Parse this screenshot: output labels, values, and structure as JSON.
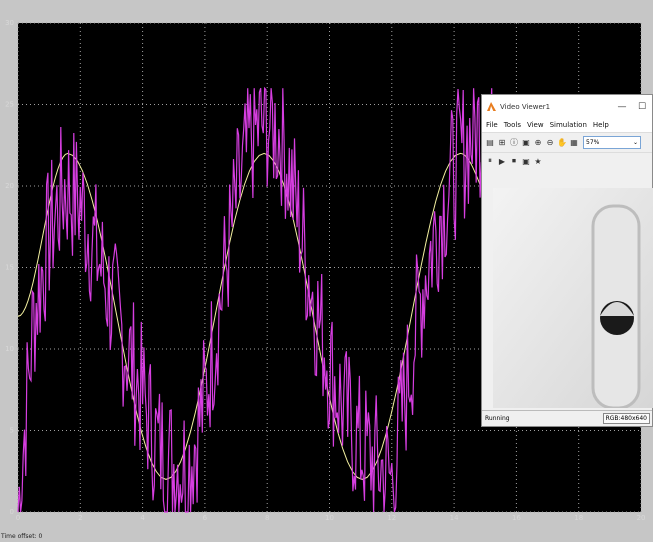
{
  "scope": {
    "time_offset_label": "Time offset:  0",
    "colors": {
      "background": "#000000",
      "frame": "#c6c6c6",
      "reference": "#f3f0a0",
      "measured": "#d63ee0",
      "grid": "#a0a0a0"
    }
  },
  "chart_data": {
    "type": "line",
    "title": "",
    "xlabel": "",
    "ylabel": "",
    "xlim": [
      0,
      20
    ],
    "ylim": [
      0,
      30
    ],
    "xticks": [
      "0",
      "2",
      "4",
      "6",
      "8",
      "10",
      "12",
      "14",
      "16",
      "18",
      "20"
    ],
    "yticks": [
      "0",
      "5",
      "10",
      "15",
      "20",
      "25",
      "30"
    ],
    "grid": true,
    "series": [
      {
        "color": "#f3f0a0",
        "x": [
          0,
          1.6,
          4.75,
          7.9,
          11.05,
          14.2,
          15.5
        ],
        "y": [
          12,
          22,
          2,
          22,
          2,
          22,
          18
        ]
      },
      {
        "color": "#d63ee0",
        "x": [
          0,
          0.5,
          1,
          1.5,
          2,
          2.5,
          3,
          3.5,
          4,
          4.5,
          5,
          5.5,
          6,
          6.5,
          7,
          7.5,
          8,
          8.5,
          9,
          9.5,
          10,
          10.5,
          11,
          11.5,
          12,
          12.5,
          13,
          13.5,
          14,
          14.5,
          15,
          15.5
        ],
        "y": [
          0,
          12,
          17,
          20,
          19,
          16,
          13,
          10,
          7,
          4,
          3,
          3,
          7,
          13,
          19,
          23,
          24,
          23,
          18,
          13,
          9,
          6,
          4,
          3,
          2,
          8,
          14,
          18,
          21,
          23,
          24,
          23
        ]
      }
    ]
  },
  "viewer": {
    "title": "Video Viewer1",
    "menu": [
      "File",
      "Tools",
      "View",
      "Simulation",
      "Help"
    ],
    "zoom_value": "57%",
    "status": "Running",
    "rgb_info": "RGB:480x640"
  }
}
